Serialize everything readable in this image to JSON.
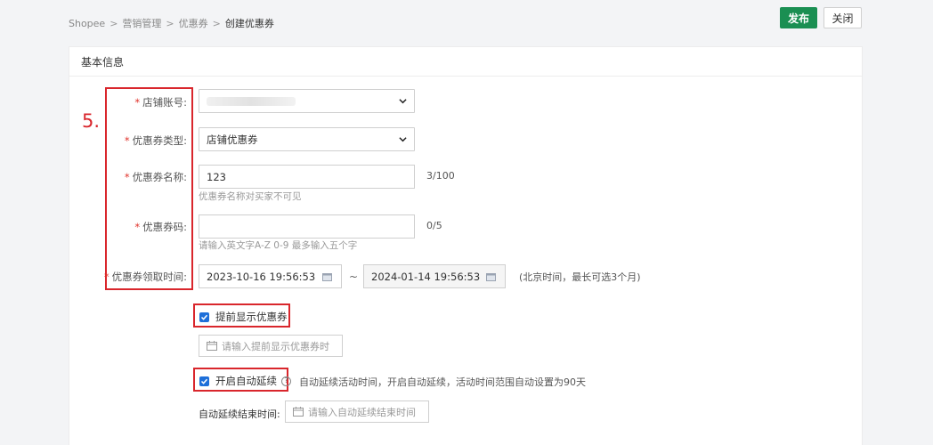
{
  "breadcrumb": {
    "items": [
      "Shopee",
      "营销管理",
      "优惠券"
    ],
    "current": "创建优惠券"
  },
  "actions": {
    "publish": "发布",
    "close": "关闭"
  },
  "section": {
    "title": "基本信息"
  },
  "annotation": {
    "step": "5."
  },
  "form": {
    "required_mark": "*",
    "shop_account": {
      "label": "店铺账号:"
    },
    "coupon_type": {
      "label": "优惠券类型:",
      "value": "店铺优惠券"
    },
    "coupon_name": {
      "label": "优惠券名称:",
      "value": "123",
      "counter": "3/100",
      "hint": "优惠券名称对买家不可见"
    },
    "coupon_code": {
      "label": "优惠券码:",
      "value": "",
      "counter": "0/5",
      "hint": "请输入英文字A-Z 0-9 最多输入五个字"
    },
    "claim_time": {
      "label": "优惠券领取时间:",
      "start": "2023-10-16 19:56:53",
      "separator": "~",
      "end": "2024-01-14 19:56:53",
      "note": "(北京时间，最长可选3个月)"
    },
    "early_display": {
      "label": "提前显示优惠券",
      "checked": true,
      "placeholder": "请输入提前显示优惠券时"
    },
    "auto_extend": {
      "label": "开启自动延续",
      "checked": true,
      "help": "?",
      "description": "自动延续活动时间，开启自动延续，活动时间范围自动设置为90天",
      "end_label": "自动延续结束时间:",
      "end_placeholder": "请输入自动延续结束时间"
    }
  },
  "colors": {
    "primary": "#1a8f52",
    "required": "#e0322a",
    "annotation": "#d9262c",
    "checkbox": "#1e6fd9"
  }
}
